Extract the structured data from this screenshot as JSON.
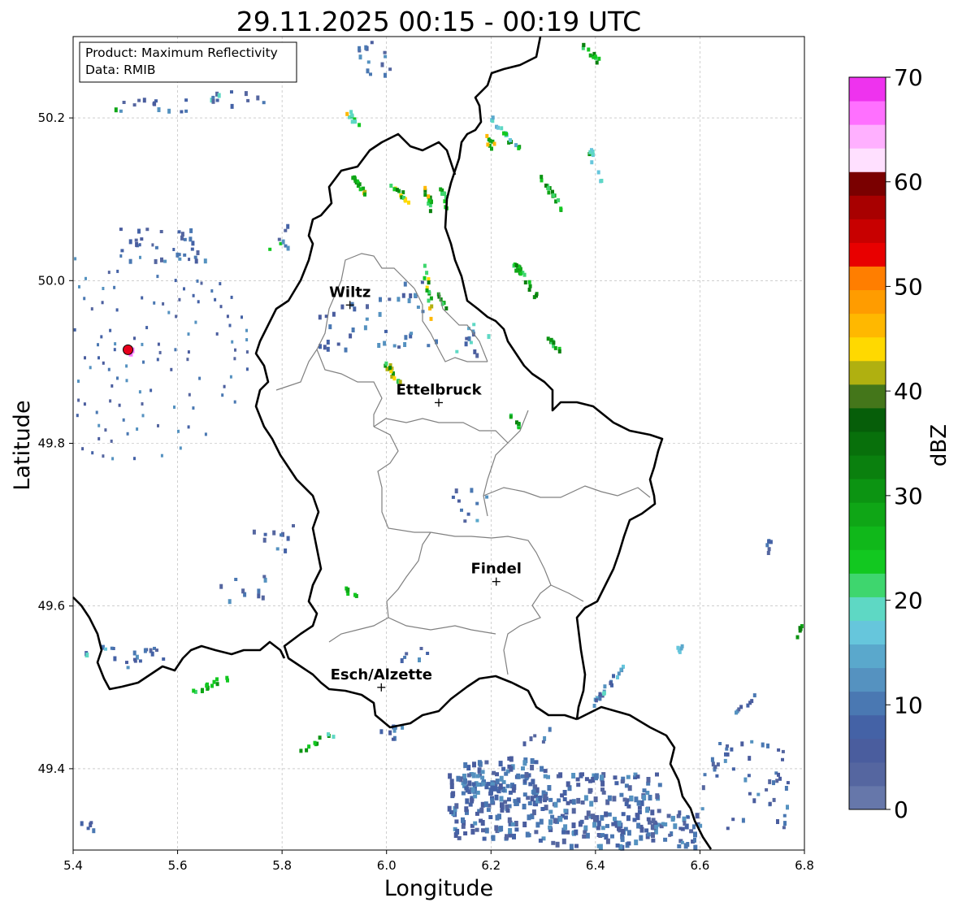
{
  "title": "29.11.2025 00:15 - 00:19 UTC",
  "info_box": {
    "product": "Product: Maximum Reflectivity",
    "data": "Data: RMIB"
  },
  "axes": {
    "xlabel": "Longitude",
    "ylabel": "Latitude",
    "xlim": [
      5.4,
      6.8
    ],
    "ylim": [
      49.3,
      50.3
    ],
    "x_ticks": [
      5.4,
      5.6,
      5.8,
      6.0,
      6.2,
      6.4,
      6.6,
      6.8
    ],
    "x_tick_labels": [
      "5.4",
      "5.6",
      "5.8",
      "6.0",
      "6.2",
      "6.4",
      "6.6",
      "6.8"
    ],
    "y_ticks": [
      49.4,
      49.6,
      49.8,
      50.0,
      50.2
    ],
    "y_tick_labels": [
      "49.4",
      "49.6",
      "49.8",
      "50.0",
      "50.2"
    ],
    "grid": true
  },
  "cities": [
    {
      "name": "Wiltz",
      "lon": 5.93,
      "lat": 49.97
    },
    {
      "name": "Ettelbruck",
      "lon": 6.1,
      "lat": 49.85
    },
    {
      "name": "Findel",
      "lon": 6.21,
      "lat": 49.63
    },
    {
      "name": "Esch/Alzette",
      "lon": 5.99,
      "lat": 49.5
    }
  ],
  "radar_site": {
    "lon": 5.505,
    "lat": 49.915,
    "color": "#e8001c"
  },
  "colorbar": {
    "label": "dBZ",
    "min": 0,
    "max": 70,
    "tick_values": [
      0,
      10,
      20,
      30,
      40,
      50,
      60,
      70
    ],
    "tick_labels": [
      "0",
      "10",
      "20",
      "30",
      "40",
      "50",
      "60",
      "70"
    ],
    "colors": [
      "#6677aa",
      "#5566a0",
      "#4a5d9e",
      "#4462a6",
      "#4a78b2",
      "#5592c0",
      "#5aa8cc",
      "#66c6dc",
      "#5ed8c4",
      "#3ed66e",
      "#12c820",
      "#10b81a",
      "#0fa616",
      "#0c9412",
      "#0a800e",
      "#08700b",
      "#065e09",
      "#44761a",
      "#b0b010",
      "#ffd900",
      "#ffb800",
      "#ff9c00",
      "#ff7e00",
      "#e80000",
      "#c80000",
      "#a80000",
      "#7a0000",
      "#ffe0ff",
      "#ffb0ff",
      "#ff70ff",
      "#ee33ee"
    ]
  },
  "colors": {
    "border": "#000000",
    "cantons": "#808080",
    "grid": "#b0b0b0"
  }
}
